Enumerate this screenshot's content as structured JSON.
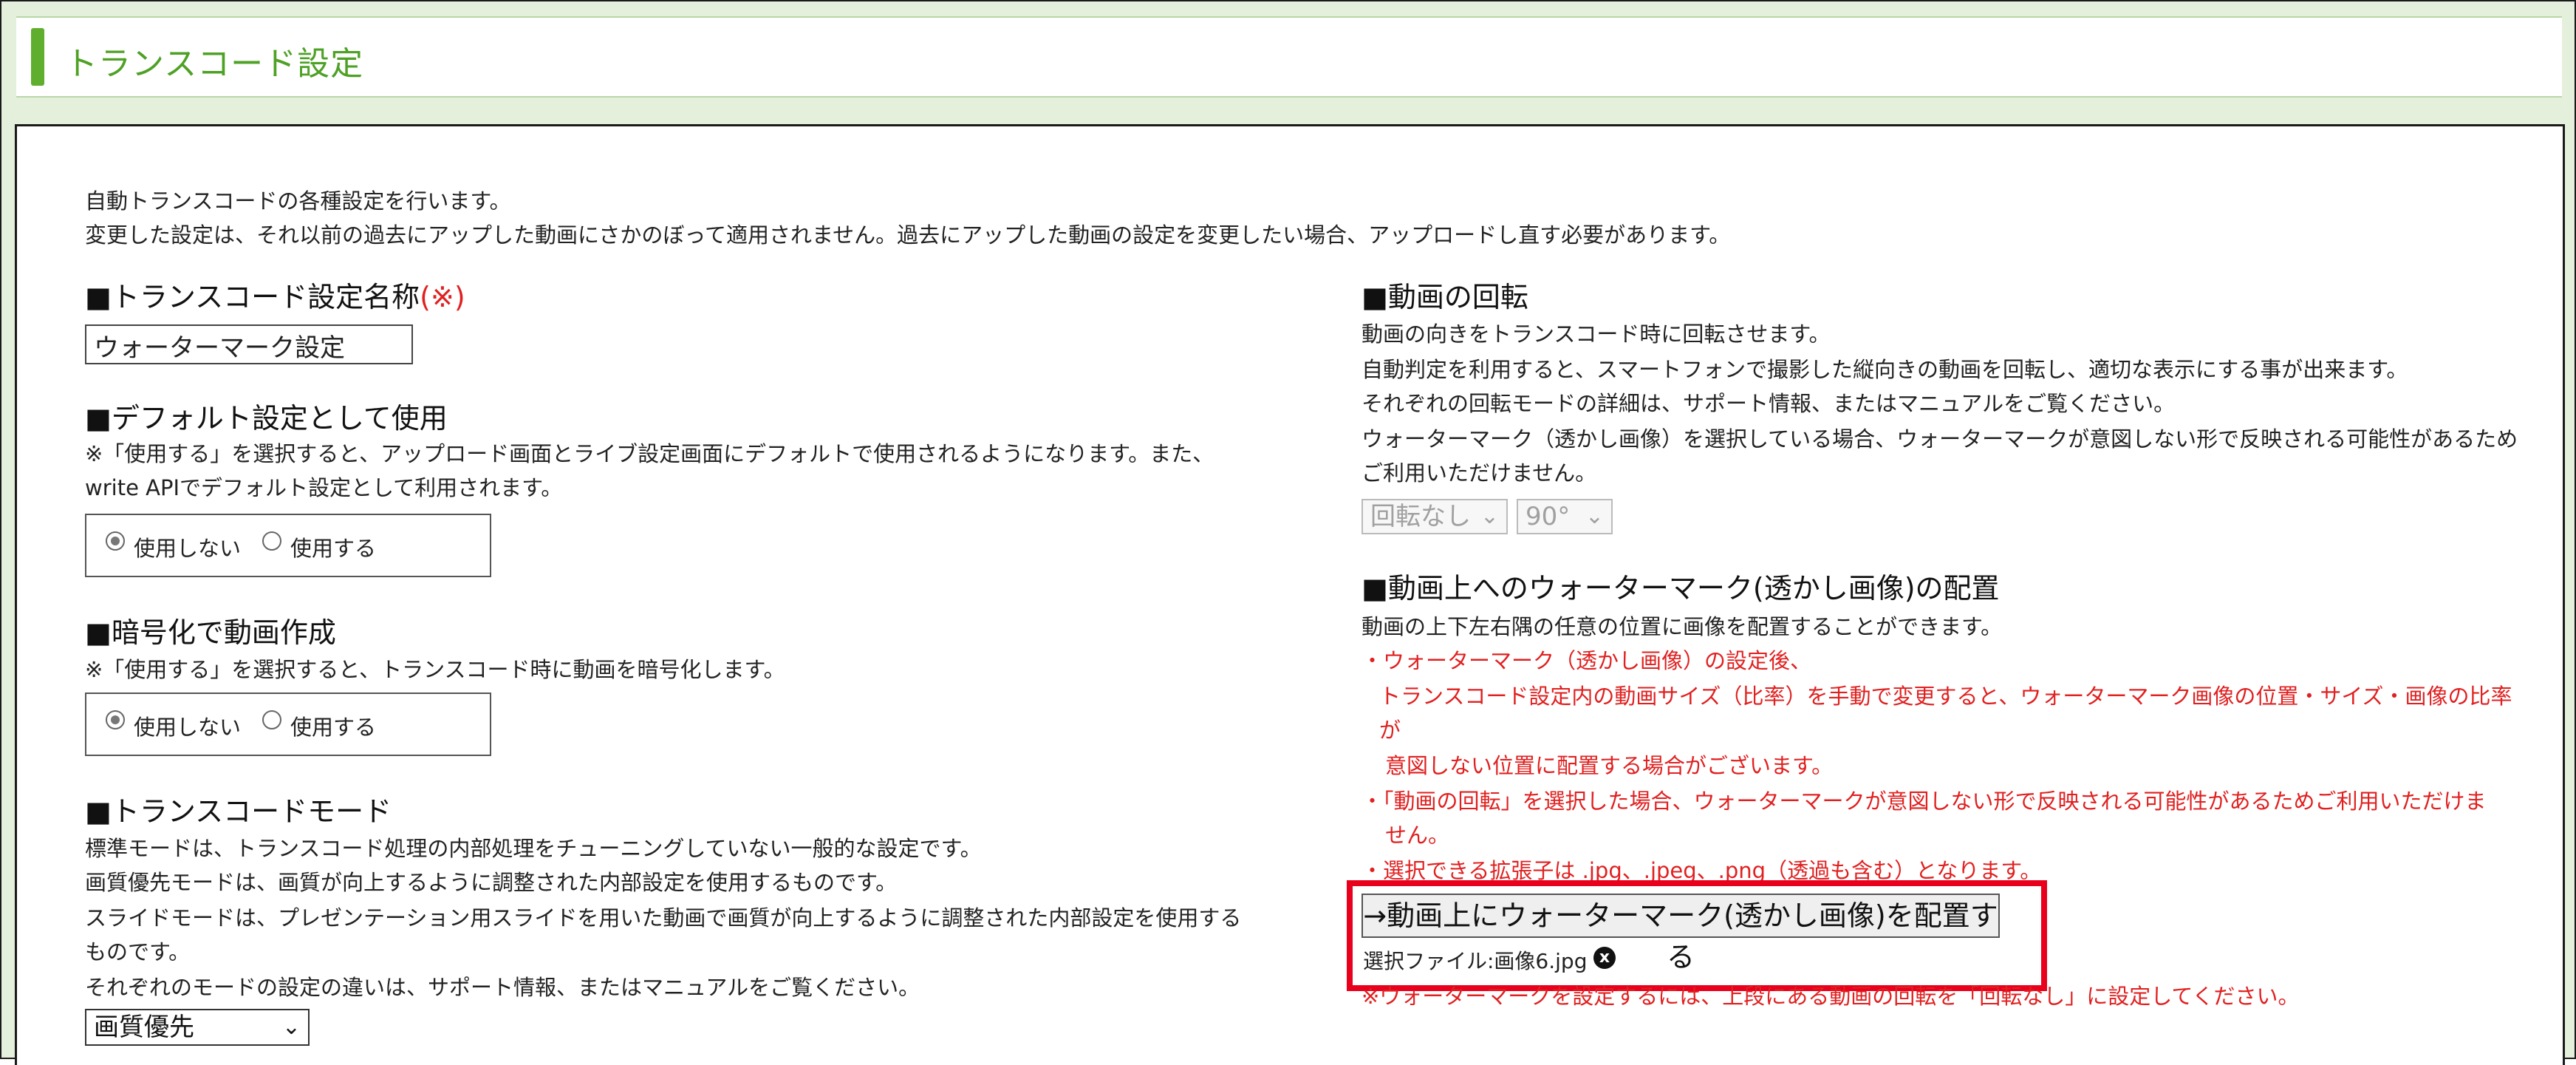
{
  "header": {
    "title": "トランスコード設定"
  },
  "intro": {
    "line1": "自動トランスコードの各種設定を行います。",
    "line2": "変更した設定は、それ以前の過去にアップした動画にさかのぼって適用されません。過去にアップした動画の設定を変更したい場合、アップロードし直す必要があります。"
  },
  "name_section": {
    "heading": "■トランスコード設定名称",
    "required_mark": "(※)",
    "input_value": "ウォーターマーク設定"
  },
  "default_section": {
    "heading": "■デフォルト設定として使用",
    "note1": "※「使用する」を選択すると、アップロード画面とライブ設定画面にデフォルトで使用されるようになります。また、",
    "note2": "write APIでデフォルト設定として利用されます。",
    "option_no": "使用しない",
    "option_yes": "使用する",
    "selected": "使用しない"
  },
  "encrypt_section": {
    "heading": "■暗号化で動画作成",
    "note": "※「使用する」を選択すると、トランスコード時に動画を暗号化します。",
    "option_no": "使用しない",
    "option_yes": "使用する",
    "selected": "使用しない"
  },
  "mode_section": {
    "heading": "■トランスコードモード",
    "line1": "標準モードは、トランスコード処理の内部処理をチューニングしていない一般的な設定です。",
    "line2": "画質優先モードは、画質が向上するように調整された内部設定を使用するものです。",
    "line3": "スライドモードは、プレゼンテーション用スライドを用いた動画で画質が向上するように調整された内部設定を使用する",
    "line4": "ものです。",
    "line5": "それぞれのモードの設定の違いは、サポート情報、またはマニュアルをご覧ください。",
    "select_value": "画質優先"
  },
  "rotation_section": {
    "heading": "■動画の回転",
    "line1": "動画の向きをトランスコード時に回転させます。",
    "line2": "自動判定を利用すると、スマートフォンで撮影した縦向きの動画を回転し、適切な表示にする事が出来ます。",
    "line3": "それぞれの回転モードの詳細は、サポート情報、またはマニュアルをご覧ください。",
    "line4": "ウォーターマーク（透かし画像）を選択している場合、ウォーターマークが意図しない形で反映される可能性があるため",
    "line5": "ご利用いただけません。",
    "select_mode": "回転なし",
    "select_angle": "90°"
  },
  "watermark_section": {
    "heading": "■動画上へのウォーターマーク(透かし画像)の配置",
    "line1": "動画の上下左右隅の任意の位置に画像を配置することができます。",
    "red1": "・ウォーターマーク（透かし画像）の設定後、",
    "red2": "トランスコード設定内の動画サイズ（比率）を手動で変更すると、ウォーターマーク画像の位置・サイズ・画像の比率",
    "red3": "が",
    "red4": "意図しない位置に配置する場合がございます。",
    "red5": "・「動画の回転」を選択した場合、ウォーターマークが意図しない形で反映される可能性があるためご利用いただけま",
    "red6": "せん。",
    "red7": "・選択できる拡張子は .jpg、.jpeg、.png（透過も含む）となります。",
    "button_label": "→動画上にウォーターマーク(透かし画像)を配置する",
    "selected_file": "選択ファイル:画像6.jpg",
    "remove_symbol": "x",
    "bottom_note": "※ウォーターマークを設定するには、上段にある動画の回転を「回転なし」に設定してください。"
  },
  "colors": {
    "accent_green": "#5fae2e",
    "title_green": "#4ea125",
    "warning_red": "#e12020",
    "highlight_red": "#e8001c"
  }
}
